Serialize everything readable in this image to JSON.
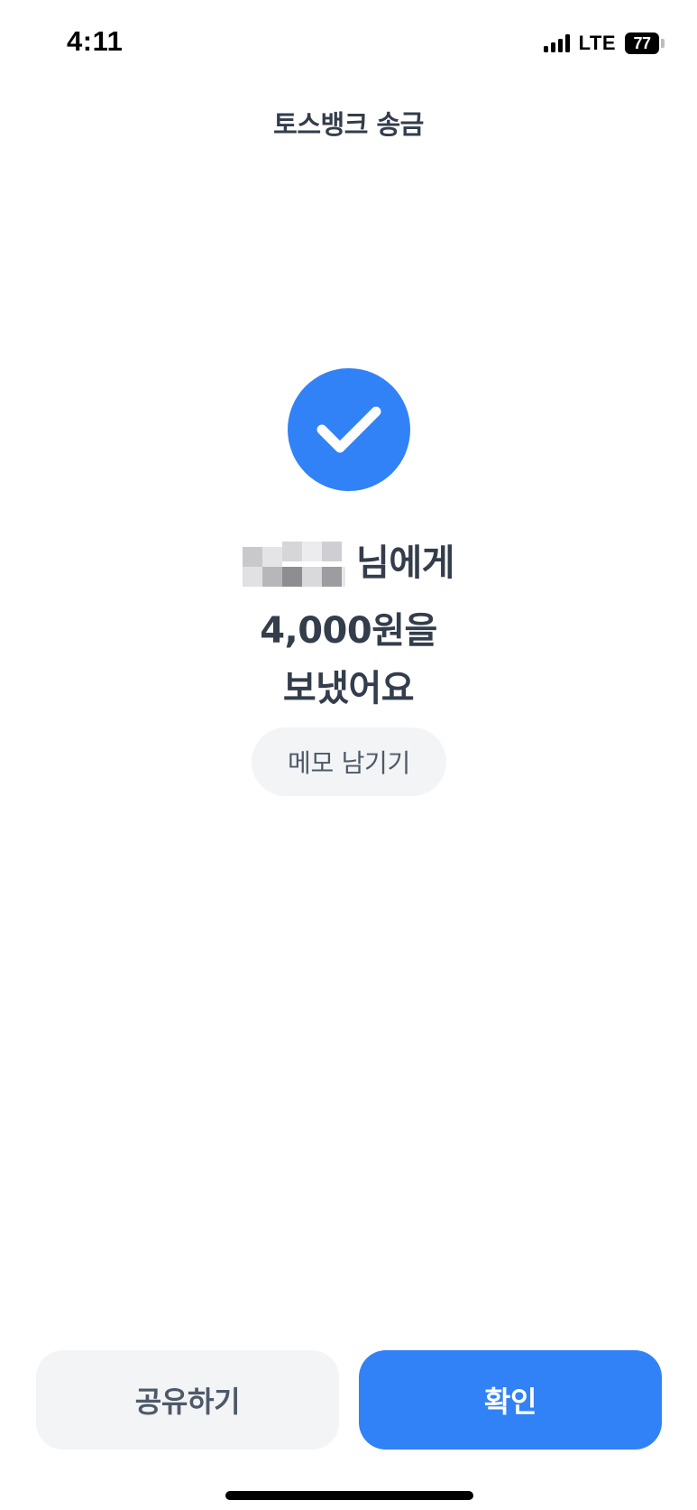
{
  "status_bar": {
    "time": "4:11",
    "network": "LTE",
    "battery_level": "77"
  },
  "header": {
    "title": "토스뱅크 송금"
  },
  "success_icon": {
    "name": "checkmark-icon",
    "color": "#3182f6"
  },
  "message": {
    "recipient_suffix": "님에게",
    "amount_line": "4,000원을",
    "result_line": "보냈어요"
  },
  "memo_button": {
    "label": "메모 남기기"
  },
  "actions": {
    "share_label": "공유하기",
    "confirm_label": "확인"
  },
  "colors": {
    "accent": "#3182f6",
    "text_primary": "#333d4b",
    "text_secondary": "#4e5968",
    "button_secondary_bg": "#f2f4f6"
  }
}
